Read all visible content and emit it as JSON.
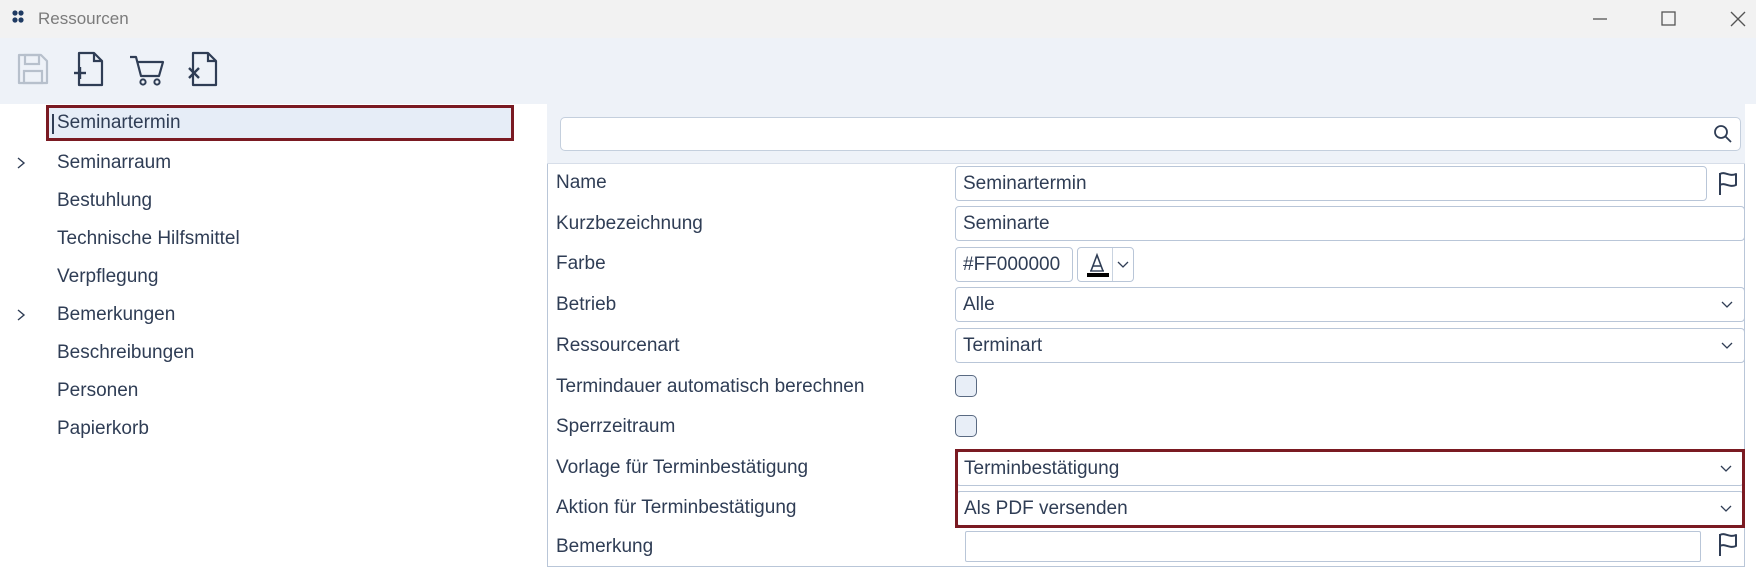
{
  "window": {
    "title": "Ressourcen"
  },
  "toolbar": {
    "buttons": [
      {
        "icon": "save-icon",
        "enabled": false
      },
      {
        "icon": "new-document-icon",
        "enabled": true
      },
      {
        "icon": "cart-icon",
        "enabled": true
      },
      {
        "icon": "delete-document-icon",
        "enabled": true
      }
    ]
  },
  "tree": {
    "items": [
      {
        "label": "Seminartermin",
        "selected": true,
        "expandable": false
      },
      {
        "label": "Seminarraum",
        "selected": false,
        "expandable": true
      },
      {
        "label": "Bestuhlung",
        "selected": false,
        "expandable": false
      },
      {
        "label": "Technische Hilfsmittel",
        "selected": false,
        "expandable": false
      },
      {
        "label": "Verpflegung",
        "selected": false,
        "expandable": false
      },
      {
        "label": "Bemerkungen",
        "selected": false,
        "expandable": true
      },
      {
        "label": "Beschreibungen",
        "selected": false,
        "expandable": false
      },
      {
        "label": "Personen",
        "selected": false,
        "expandable": false
      },
      {
        "label": "Papierkorb",
        "selected": false,
        "expandable": false
      }
    ]
  },
  "form": {
    "search": {
      "value": ""
    },
    "name": {
      "label": "Name",
      "value": "Seminartermin"
    },
    "kurz": {
      "label": "Kurzbezeichnung",
      "value": "Seminarte"
    },
    "farbe": {
      "label": "Farbe",
      "value": "#FF000000"
    },
    "betrieb": {
      "label": "Betrieb",
      "value": "Alle"
    },
    "ressourcenart": {
      "label": "Ressourcenart",
      "value": "Terminart"
    },
    "termindauer": {
      "label": "Termindauer automatisch berechnen",
      "checked": false
    },
    "sperrzeitraum": {
      "label": "Sperrzeitraum",
      "checked": false
    },
    "vorlage": {
      "label": "Vorlage für Terminbestätigung",
      "value": "Terminbestätigung"
    },
    "aktion": {
      "label": "Aktion für Terminbestätigung",
      "value": "Als PDF versenden"
    },
    "bemerkung": {
      "label": "Bemerkung",
      "value": ""
    }
  },
  "colors": {
    "highlight_frame": "#7a1a22",
    "text": "#2f3d55",
    "toolbar_bg": "#eef2f8",
    "selected_bg": "#e6edf7"
  }
}
